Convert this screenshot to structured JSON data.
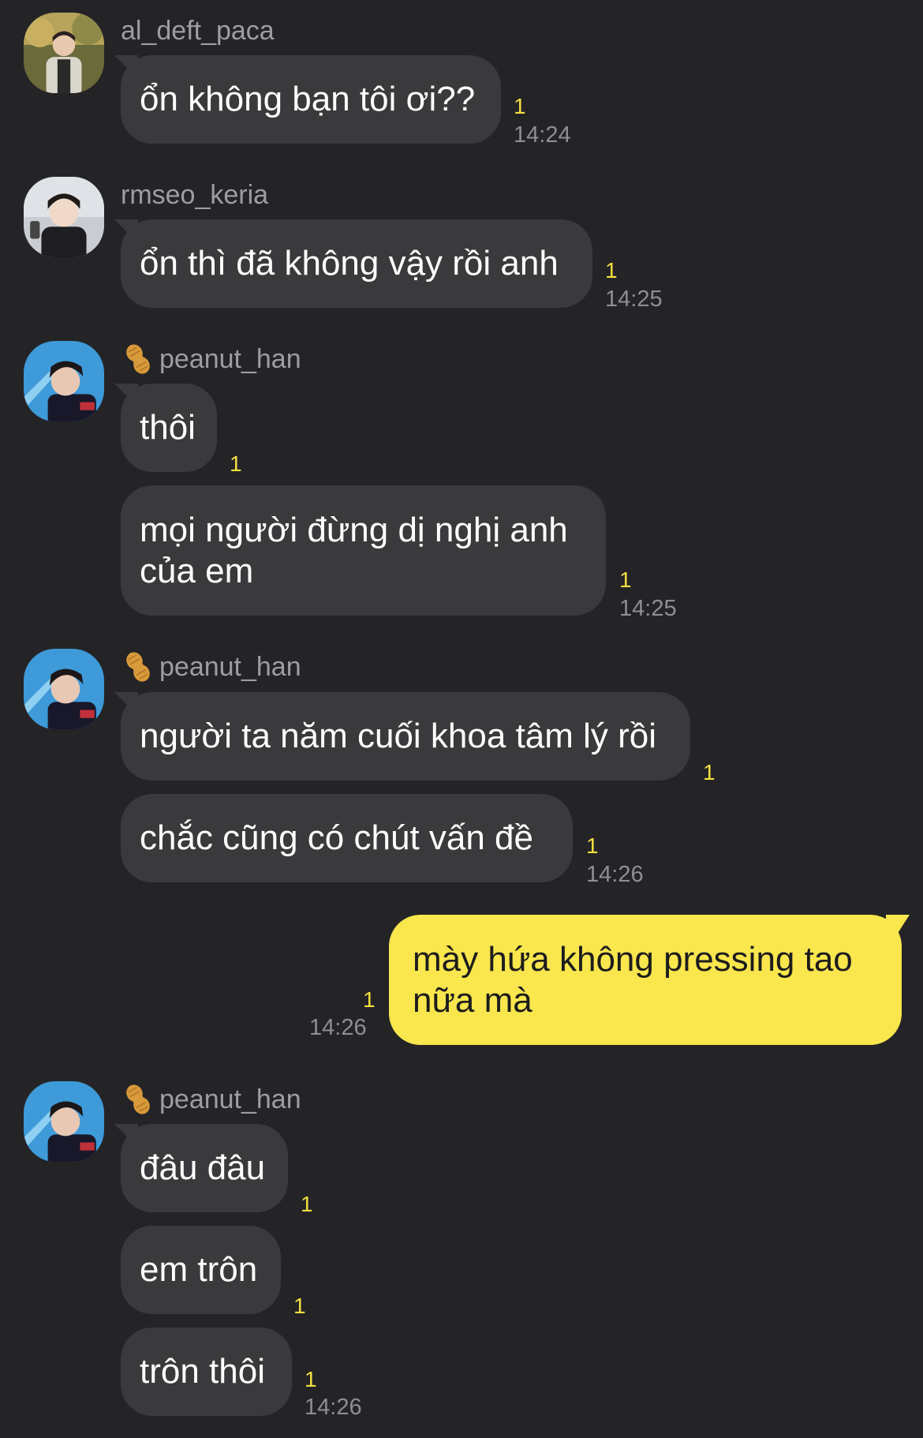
{
  "messages": [
    {
      "sender": "al_deft_paca",
      "text": "ổn không bạn tôi ơi??",
      "unread": "1",
      "time": "14:24"
    },
    {
      "sender": "rmseo_keria",
      "text": "ổn thì đã không vậy rồi anh",
      "unread": "1",
      "time": "14:25"
    },
    {
      "sender": "peanut_han",
      "text": "thôi",
      "unread": "1"
    },
    {
      "sender": "peanut_han",
      "text": "mọi người đừng dị nghị anh của em",
      "unread": "1",
      "time": "14:25"
    },
    {
      "sender": "peanut_han",
      "text": "người ta năm cuối khoa tâm lý rồi",
      "unread": "1"
    },
    {
      "sender": "peanut_han",
      "text": "chắc cũng có chút vấn đề",
      "unread": "1",
      "time": "14:26"
    },
    {
      "sender": "me",
      "text": "mày hứa không pressing tao nữa mà",
      "unread": "1",
      "time": "14:26"
    },
    {
      "sender": "peanut_han",
      "text": "đâu đâu",
      "unread": "1"
    },
    {
      "sender": "peanut_han",
      "text": "em trôn",
      "unread": "1"
    },
    {
      "sender": "peanut_han",
      "text": "trôn thôi",
      "unread": "1",
      "time": "14:26"
    }
  ],
  "names": {
    "g1": "al_deft_paca",
    "g2": "rmseo_keria",
    "g3": "peanut_han",
    "g4": "peanut_han",
    "g5": "peanut_han"
  },
  "icons": {
    "peanut": "peanut-icon",
    "avatar": "avatar"
  },
  "colors": {
    "background": "#242427",
    "incoming_bubble": "#3a3a3d",
    "outgoing_bubble": "#fae64d",
    "unread": "#f4df3e",
    "time": "#8e8e93",
    "name": "#9d9da2"
  }
}
